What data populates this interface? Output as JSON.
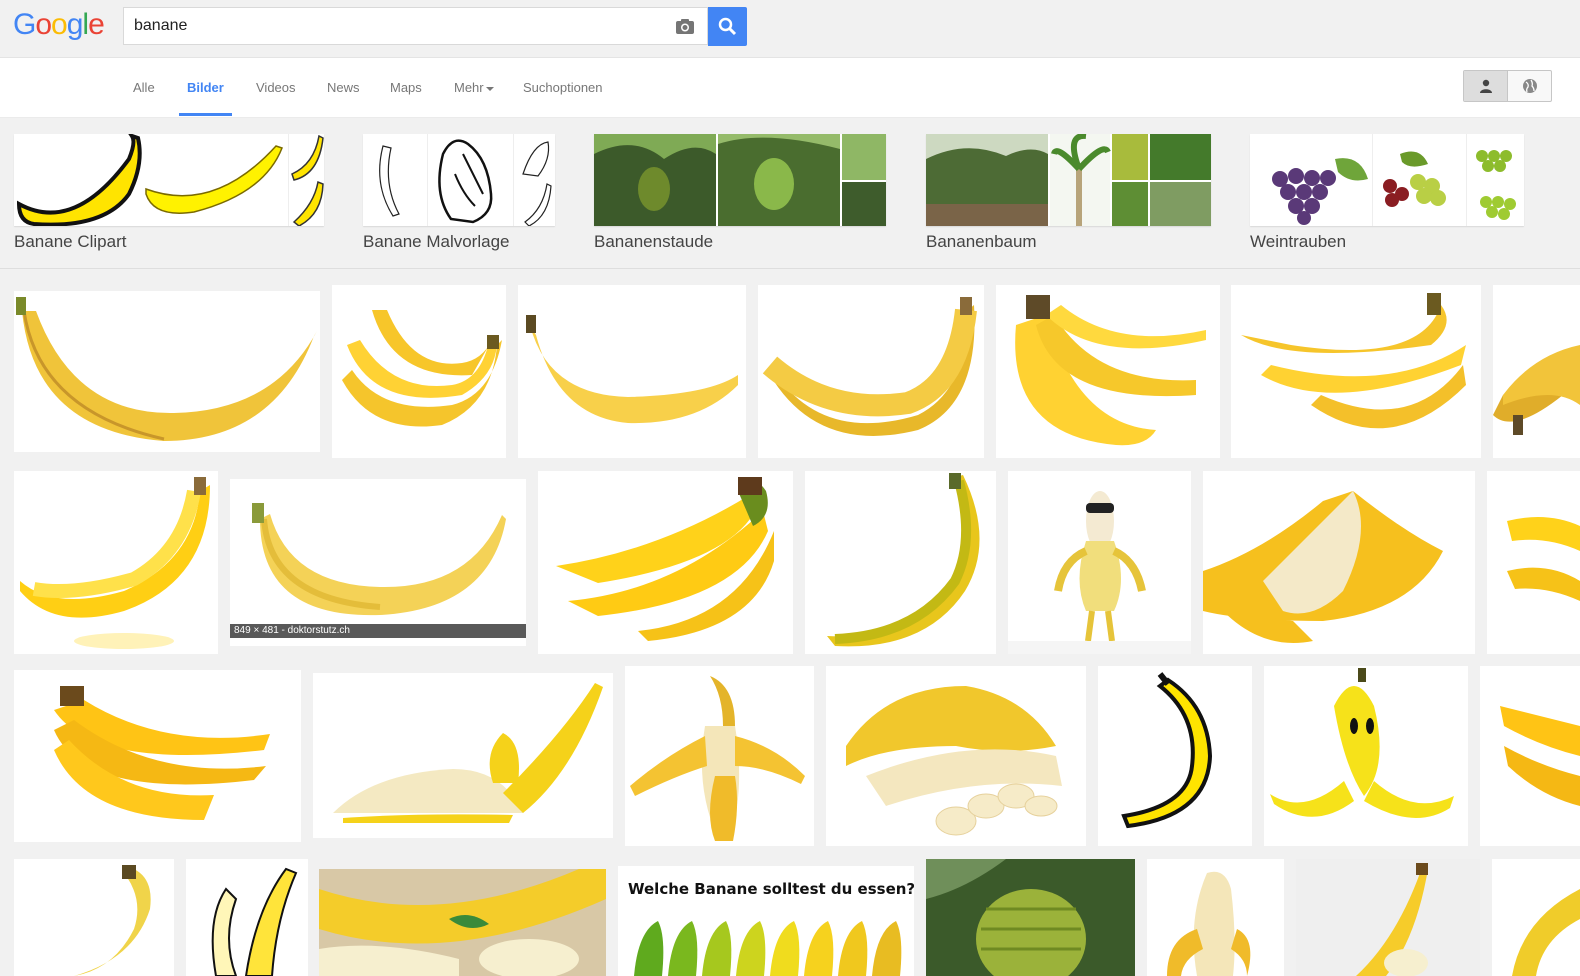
{
  "header": {
    "logo_letters": [
      {
        "ch": "G",
        "color": "#4285f4"
      },
      {
        "ch": "o",
        "color": "#ea4335"
      },
      {
        "ch": "o",
        "color": "#fbbc05"
      },
      {
        "ch": "g",
        "color": "#4285f4"
      },
      {
        "ch": "l",
        "color": "#34a853"
      },
      {
        "ch": "e",
        "color": "#ea4335"
      }
    ],
    "search_query": "banane",
    "camera_icon": "camera-icon",
    "search_icon": "search-icon",
    "accent": "#4285f4"
  },
  "nav": {
    "tabs": [
      {
        "label": "Alle",
        "active": false
      },
      {
        "label": "Bilder",
        "active": true
      },
      {
        "label": "Videos",
        "active": false
      },
      {
        "label": "News",
        "active": false
      },
      {
        "label": "Maps",
        "active": false
      },
      {
        "label": "Mehr",
        "active": false
      },
      {
        "label": "Suchoptionen",
        "active": false
      }
    ],
    "toggle_icons": [
      "person-icon",
      "globe-icon"
    ]
  },
  "related": [
    {
      "label": "Banane Clipart"
    },
    {
      "label": "Banane Malvorlage"
    },
    {
      "label": "Bananenstaude"
    },
    {
      "label": "Bananenbaum"
    },
    {
      "label": "Weintrauben"
    }
  ],
  "results": {
    "hover_meta": "849 × 481 - doktorstutz.ch",
    "card_text": "Welche Banane solltest du essen?"
  }
}
